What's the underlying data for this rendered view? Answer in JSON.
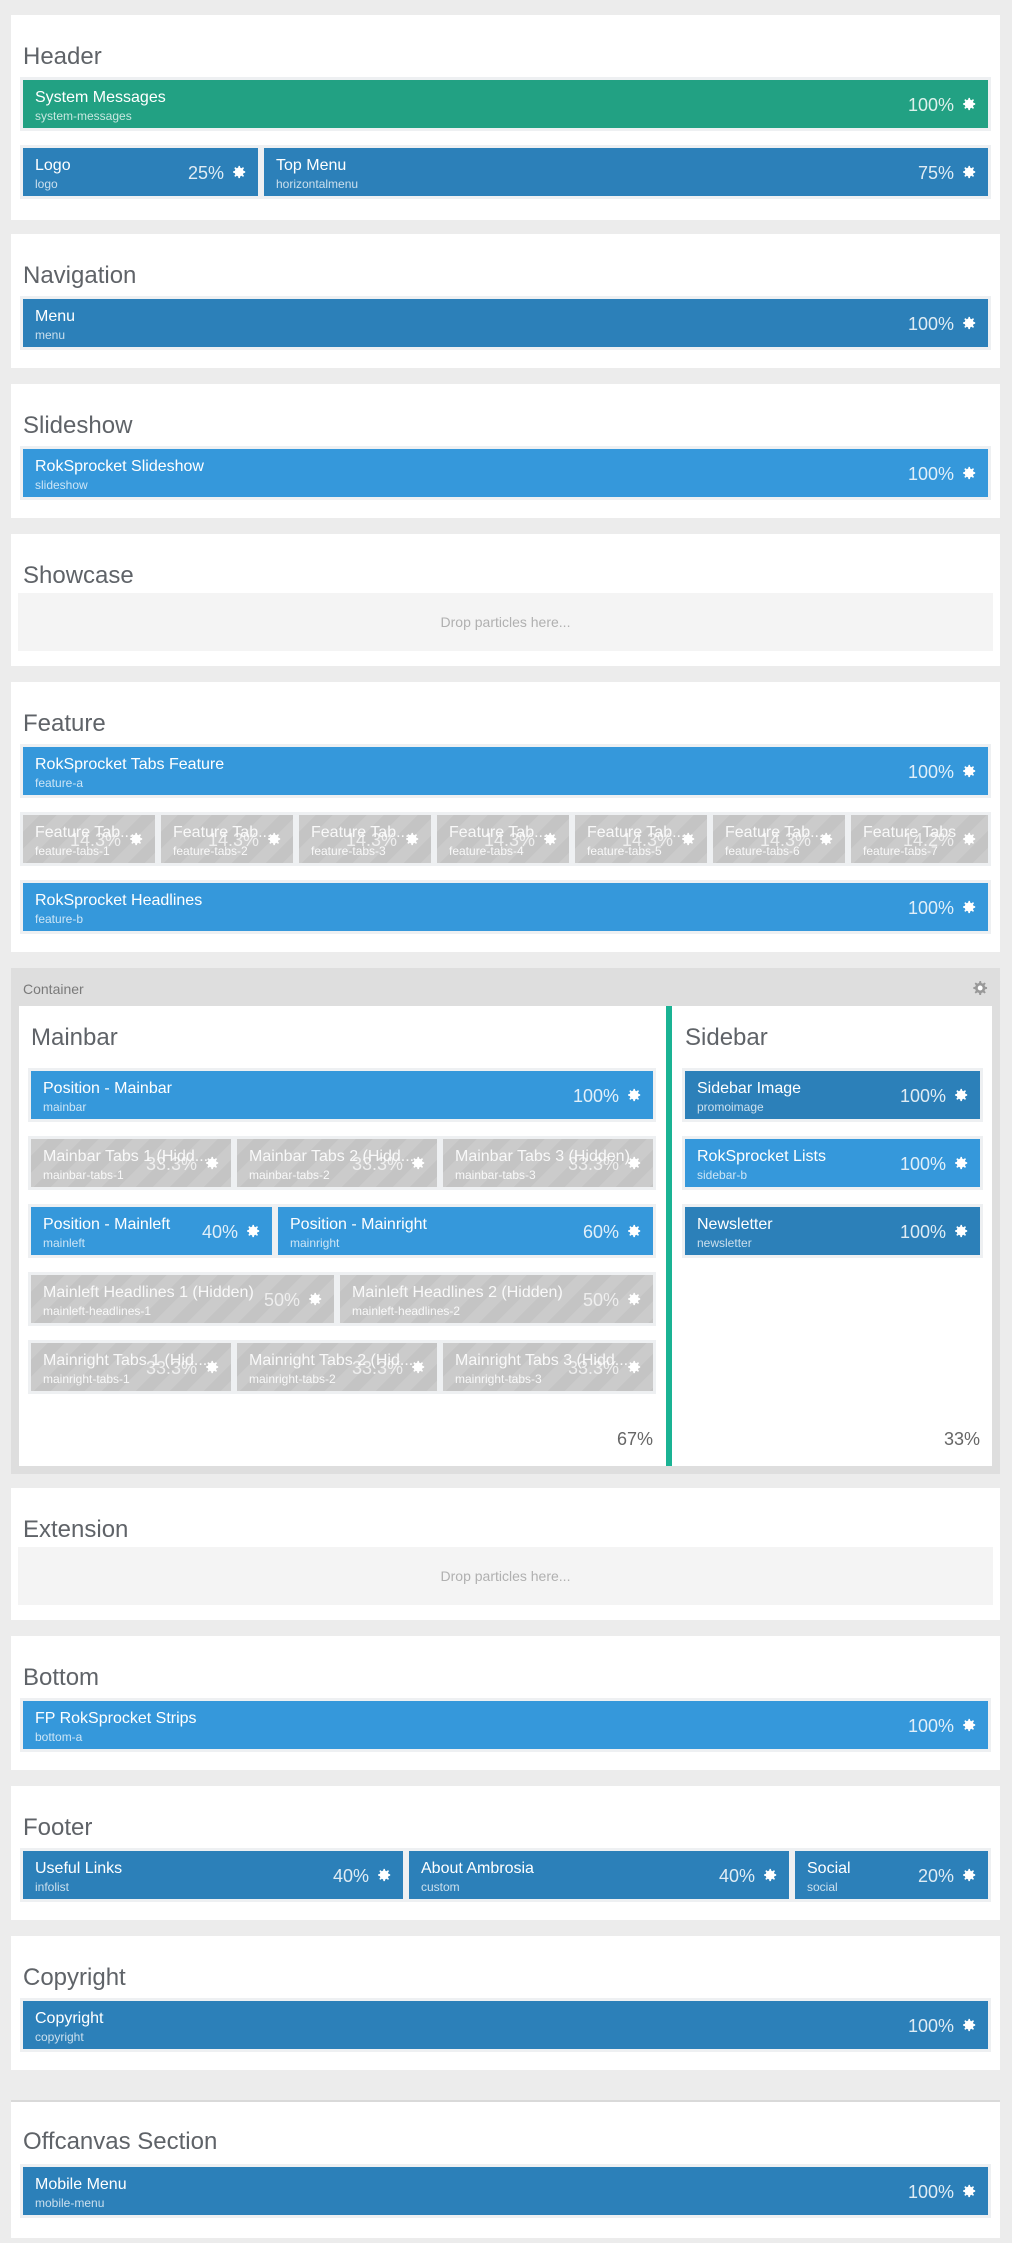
{
  "drop_text": "Drop particles here...",
  "colors": {
    "teal": "#22a183",
    "dark_blue": "#2c80b9",
    "light_blue": "#3598db",
    "hidden": "#c4c4c4",
    "divider": "#1ab394"
  },
  "icons": {
    "block_settings": "cog-icon",
    "container_settings": "cog-icon"
  },
  "sections": {
    "header": {
      "title": "Header",
      "blocks": [
        {
          "name": "System Messages",
          "key": "system-messages",
          "pct": "100%"
        },
        {
          "name": "Logo",
          "key": "logo",
          "pct": "25%"
        },
        {
          "name": "Top Menu",
          "key": "horizontalmenu",
          "pct": "75%"
        }
      ]
    },
    "navigation": {
      "title": "Navigation",
      "blocks": [
        {
          "name": "Menu",
          "key": "menu",
          "pct": "100%"
        }
      ]
    },
    "slideshow": {
      "title": "Slideshow",
      "blocks": [
        {
          "name": "RokSprocket Slideshow",
          "key": "slideshow",
          "pct": "100%"
        }
      ]
    },
    "showcase": {
      "title": "Showcase"
    },
    "feature": {
      "title": "Feature",
      "blocks": [
        {
          "name": "RokSprocket Tabs Feature",
          "key": "feature-a",
          "pct": "100%"
        },
        {
          "name": "Feature Tab...",
          "key": "feature-tabs-1",
          "pct": "14.3%"
        },
        {
          "name": "Feature Tab...",
          "key": "feature-tabs-2",
          "pct": "14.3%"
        },
        {
          "name": "Feature Tab...",
          "key": "feature-tabs-3",
          "pct": "14.3%"
        },
        {
          "name": "Feature Tab...",
          "key": "feature-tabs-4",
          "pct": "14.3%"
        },
        {
          "name": "Feature Tab...",
          "key": "feature-tabs-5",
          "pct": "14.3%"
        },
        {
          "name": "Feature Tab...",
          "key": "feature-tabs-6",
          "pct": "14.3%"
        },
        {
          "name": "Feature Tabs",
          "key": "feature-tabs-7",
          "pct": "14.2%"
        },
        {
          "name": "RokSprocket Headlines",
          "key": "feature-b",
          "pct": "100%"
        }
      ]
    },
    "container": {
      "label": "Container",
      "mainbar": {
        "title": "Mainbar",
        "pct": "67%",
        "blocks": [
          {
            "name": "Position - Mainbar",
            "key": "mainbar",
            "pct": "100%"
          },
          {
            "name": "Mainbar Tabs 1 (Hidd...",
            "key": "mainbar-tabs-1",
            "pct": "33.3%"
          },
          {
            "name": "Mainbar Tabs 2 (Hidd...",
            "key": "mainbar-tabs-2",
            "pct": "33.3%"
          },
          {
            "name": "Mainbar Tabs 3 (Hidden)",
            "key": "mainbar-tabs-3",
            "pct": "33.3%"
          },
          {
            "name": "Position - Mainleft",
            "key": "mainleft",
            "pct": "40%"
          },
          {
            "name": "Position - Mainright",
            "key": "mainright",
            "pct": "60%"
          },
          {
            "name": "Mainleft Headlines 1 (Hidden)",
            "key": "mainleft-headlines-1",
            "pct": "50%"
          },
          {
            "name": "Mainleft Headlines 2 (Hidden)",
            "key": "mainleft-headlines-2",
            "pct": "50%"
          },
          {
            "name": "Mainright Tabs 1 (Hid...",
            "key": "mainright-tabs-1",
            "pct": "33.3%"
          },
          {
            "name": "Mainright Tabs 2 (Hid...",
            "key": "mainright-tabs-2",
            "pct": "33.3%"
          },
          {
            "name": "Mainright Tabs 3 (Hidd...",
            "key": "mainright-tabs-3",
            "pct": "33.3%"
          }
        ]
      },
      "sidebar": {
        "title": "Sidebar",
        "pct": "33%",
        "blocks": [
          {
            "name": "Sidebar Image",
            "key": "promoimage",
            "pct": "100%"
          },
          {
            "name": "RokSprocket Lists",
            "key": "sidebar-b",
            "pct": "100%"
          },
          {
            "name": "Newsletter",
            "key": "newsletter",
            "pct": "100%"
          }
        ]
      }
    },
    "extension": {
      "title": "Extension"
    },
    "bottom": {
      "title": "Bottom",
      "blocks": [
        {
          "name": "FP RokSprocket Strips",
          "key": "bottom-a",
          "pct": "100%"
        }
      ]
    },
    "footer": {
      "title": "Footer",
      "blocks": [
        {
          "name": "Useful Links",
          "key": "infolist",
          "pct": "40%"
        },
        {
          "name": "About Ambrosia",
          "key": "custom",
          "pct": "40%"
        },
        {
          "name": "Social",
          "key": "social",
          "pct": "20%"
        }
      ]
    },
    "copyright": {
      "title": "Copyright",
      "blocks": [
        {
          "name": "Copyright",
          "key": "copyright",
          "pct": "100%"
        }
      ]
    },
    "offcanvas": {
      "title": "Offcanvas Section",
      "blocks": [
        {
          "name": "Mobile Menu",
          "key": "mobile-menu",
          "pct": "100%"
        }
      ]
    }
  }
}
